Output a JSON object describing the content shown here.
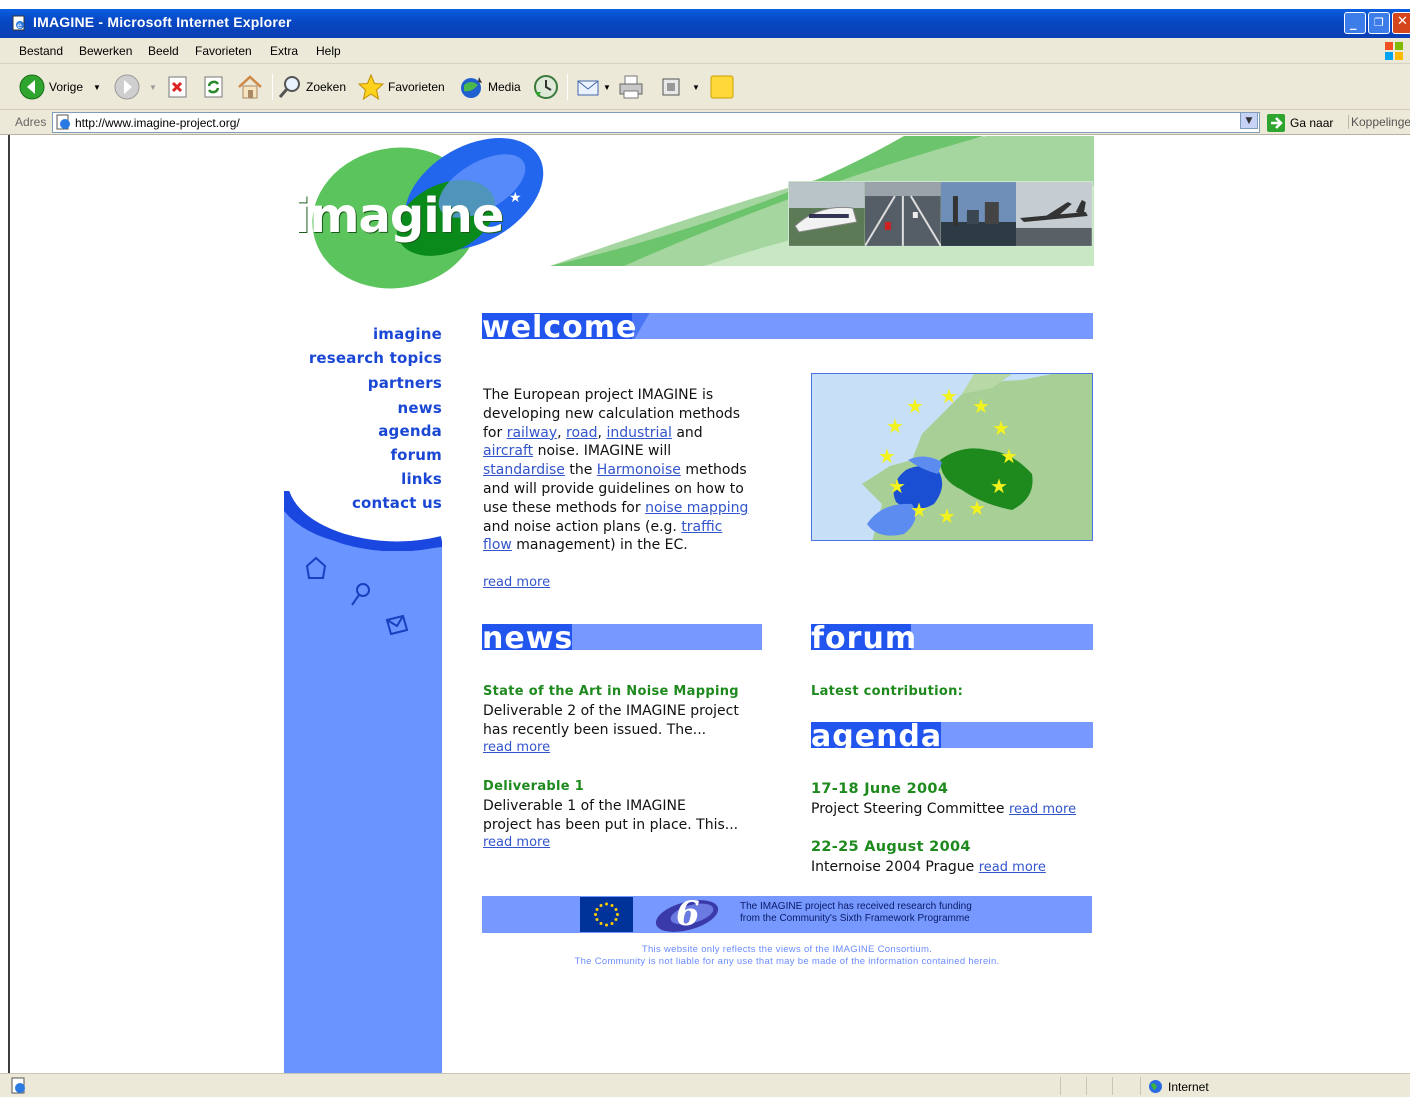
{
  "window": {
    "title": "IMAGINE - Microsoft Internet Explorer"
  },
  "menu": [
    "Bestand",
    "Bewerken",
    "Beeld",
    "Favorieten",
    "Extra",
    "Help"
  ],
  "toolbar": {
    "back": "Vorige",
    "search": "Zoeken",
    "favorites": "Favorieten",
    "media": "Media"
  },
  "address": {
    "label": "Adres",
    "url": "http://www.imagine-project.org/",
    "go": "Ga naar",
    "links": "Koppelingen"
  },
  "site": {
    "logo_text": "imagine",
    "nav": [
      "imagine",
      "research topics",
      "partners",
      "news",
      "agenda",
      "forum",
      "links",
      "contact us"
    ],
    "welcome": {
      "heading": "welcome",
      "text_lines": [
        "The European project IMAGINE is",
        "developing new calculation methods"
      ],
      "for": "for",
      "links": {
        "railway": "railway",
        "road": "road",
        "industrial": "industrial",
        "aircraft": "aircraft",
        "standardise": "standardise",
        "harmonoise": "Harmonoise",
        "noise_mapping": "noise mapping",
        "traffic": "traffic",
        "flow": "flow"
      },
      "and": "and",
      "noise_will": "noise. IMAGINE will",
      "the": "the",
      "methods": "methods",
      "line_guidelines": "and will provide guidelines on how to",
      "use_methods": "use these methods for",
      "action_plans": "and noise action plans (e.g.",
      "management": "management) in the EC.",
      "read_more": "read more"
    },
    "news": {
      "heading": "news",
      "items": [
        {
          "title": "State of the Art in Noise Mapping",
          "lines": [
            "Deliverable 2 of the IMAGINE project",
            "has recently been issued. The..."
          ],
          "read_more": "read more"
        },
        {
          "title": "Deliverable 1",
          "lines": [
            "Deliverable 1 of the IMAGINE",
            "project has been put in place. This..."
          ],
          "read_more": "read more"
        }
      ]
    },
    "forum": {
      "heading": "forum",
      "latest": "Latest contribution:"
    },
    "agenda": {
      "heading": "agenda",
      "items": [
        {
          "date": "17-18 June 2004",
          "text": "Project Steering Committee",
          "read_more": "read more"
        },
        {
          "date": "22-25 August 2004",
          "text": "Internoise 2004 Prague",
          "read_more": "read more"
        }
      ]
    },
    "funding": {
      "line1": "The IMAGINE project has received research funding",
      "line2": "from the Community's Sixth Framework Programme",
      "fp_number": "6"
    },
    "disclaimer": {
      "line1": "This website only reflects the views of the IMAGINE Consortium.",
      "line2": "The Community is not liable for any use that may be made of the information contained herein."
    }
  },
  "status": {
    "zone": "Internet"
  },
  "colors": {
    "xp_blue": "#0a4fd4",
    "site_blue": "#7799ff",
    "site_dark_blue": "#1a47d4",
    "site_green": "#1e8a1e",
    "link": "#3355cc"
  }
}
